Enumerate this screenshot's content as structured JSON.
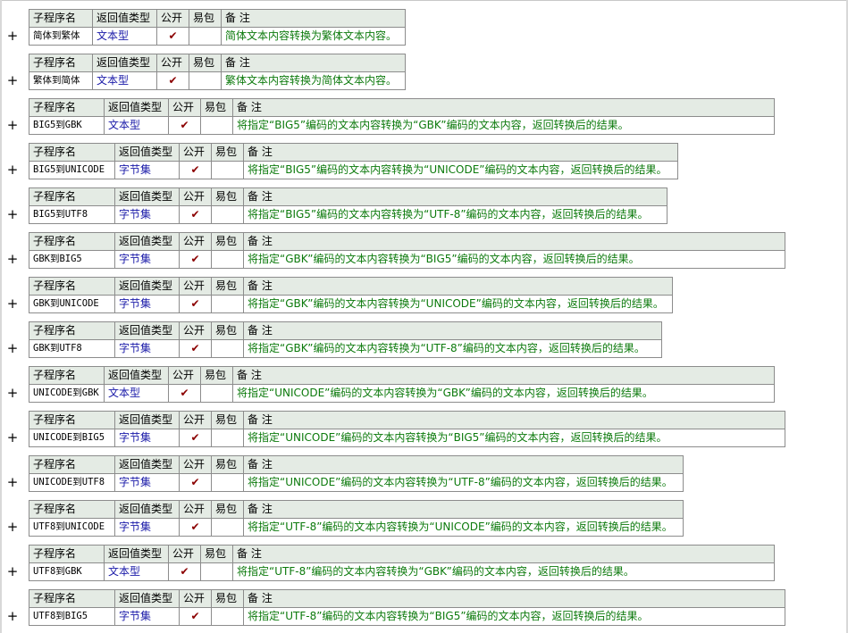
{
  "headers": {
    "name": "子程序名",
    "type": "返回值类型",
    "public": "公开",
    "lib": "易包",
    "note": "备 注"
  },
  "expand_symbol": "+",
  "check_symbol": "✔",
  "colors": {
    "header_bg": "#e4ebe4",
    "border": "#8c8c8c",
    "type_text": "#1a1aa8",
    "note_text": "#0c7a0c",
    "check": "#8b0000"
  },
  "subroutines": [
    {
      "name": "简体到繁体",
      "type": "文本型",
      "public": true,
      "note": "简体文本内容转换为繁体文本内容。"
    },
    {
      "name": "繁体到简体",
      "type": "文本型",
      "public": true,
      "note": "繁体文本内容转换为简体文本内容。"
    },
    {
      "name": "BIG5到GBK",
      "type": "文本型",
      "public": true,
      "note": "将指定“BIG5”编码的文本内容转换为“GBK”编码的文本内容，返回转换后的结果。"
    },
    {
      "name": "BIG5到UNICODE",
      "type": "字节集",
      "public": true,
      "note": "将指定“BIG5”编码的文本内容转换为“UNICODE”编码的文本内容，返回转换后的结果。"
    },
    {
      "name": "BIG5到UTF8",
      "type": "字节集",
      "public": true,
      "note": "将指定“BIG5”编码的文本内容转换为“UTF-8”编码的文本内容，返回转换后的结果。"
    },
    {
      "name": "GBK到BIG5",
      "type": "字节集",
      "public": true,
      "note": "将指定“GBK”编码的文本内容转换为“BIG5”编码的文本内容，返回转换后的结果。"
    },
    {
      "name": "GBK到UNICODE",
      "type": "字节集",
      "public": true,
      "note": "将指定“GBK”编码的文本内容转换为“UNICODE”编码的文本内容，返回转换后的结果。"
    },
    {
      "name": "GBK到UTF8",
      "type": "字节集",
      "public": true,
      "note": "将指定“GBK”编码的文本内容转换为“UTF-8”编码的文本内容，返回转换后的结果。"
    },
    {
      "name": "UNICODE到GBK",
      "type": "文本型",
      "public": true,
      "note": "将指定“UNICODE”编码的文本内容转换为“GBK”编码的文本内容，返回转换后的结果。"
    },
    {
      "name": "UNICODE到BIG5",
      "type": "字节集",
      "public": true,
      "note": "将指定“UNICODE”编码的文本内容转换为“BIG5”编码的文本内容，返回转换后的结果。"
    },
    {
      "name": "UNICODE到UTF8",
      "type": "字节集",
      "public": true,
      "note": "将指定“UNICODE”编码的文本内容转换为“UTF-8”编码的文本内容，返回转换后的结果。"
    },
    {
      "name": "UTF8到UNICODE",
      "type": "字节集",
      "public": true,
      "note": "将指定“UTF-8”编码的文本内容转换为“UNICODE”编码的文本内容，返回转换后的结果。"
    },
    {
      "name": "UTF8到GBK",
      "type": "文本型",
      "public": true,
      "note": "将指定“UTF-8”编码的文本内容转换为“GBK”编码的文本内容，返回转换后的结果。"
    },
    {
      "name": "UTF8到BIG5",
      "type": "字节集",
      "public": true,
      "note": "将指定“UTF-8”编码的文本内容转换为“BIG5”编码的文本内容，返回转换后的结果。"
    }
  ]
}
